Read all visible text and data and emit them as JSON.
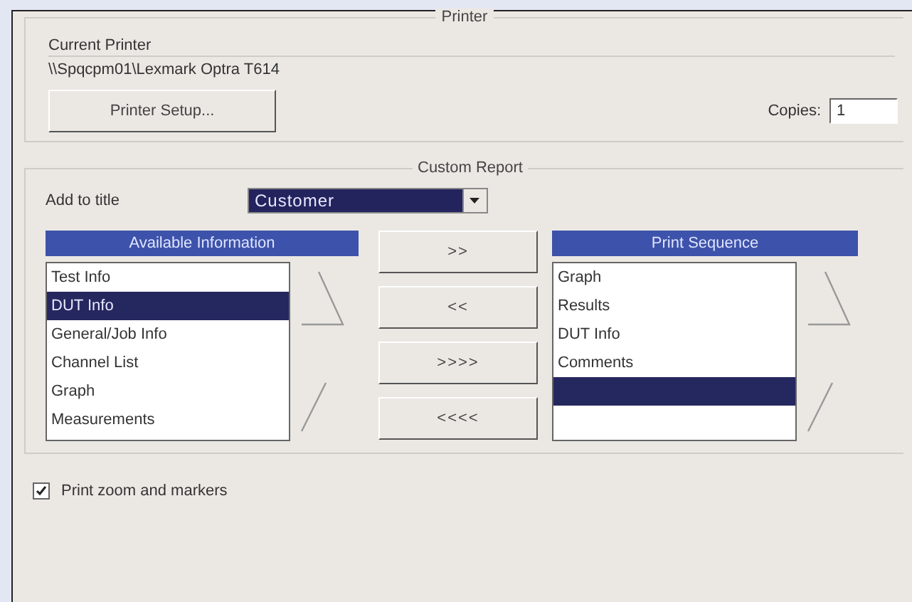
{
  "printer": {
    "title": "Printer",
    "current_label": "Current Printer",
    "current_path": "\\\\Spqcpm01\\Lexmark Optra T614",
    "setup_button": "Printer Setup...",
    "copies_label": "Copies:",
    "copies_value": "1"
  },
  "custom_report": {
    "title": "Custom Report",
    "add_to_title_label": "Add to title",
    "add_to_title_value": "Customer",
    "available": {
      "title": "Available Information",
      "items": [
        {
          "label": "Test Info",
          "selected": false
        },
        {
          "label": "DUT Info",
          "selected": true
        },
        {
          "label": "General/Job Info",
          "selected": false
        },
        {
          "label": "Channel List",
          "selected": false
        },
        {
          "label": "Graph",
          "selected": false
        },
        {
          "label": "Measurements",
          "selected": false
        }
      ]
    },
    "move_buttons": [
      ">>",
      "<<",
      ">>>>",
      "<<<<"
    ],
    "sequence": {
      "title": "Print Sequence",
      "items": [
        {
          "label": "Graph",
          "selected": false
        },
        {
          "label": "Results",
          "selected": false
        },
        {
          "label": "DUT Info",
          "selected": false
        },
        {
          "label": "Comments",
          "selected": false
        },
        {
          "selected": true
        }
      ]
    }
  },
  "print_zoom": {
    "label": "Print zoom and markers",
    "checked": true
  }
}
